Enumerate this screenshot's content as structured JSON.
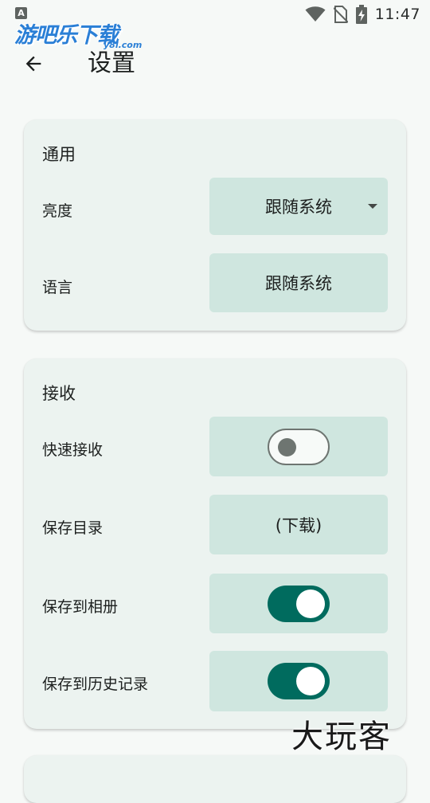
{
  "status_bar": {
    "notification_letter": "A",
    "time": "11:47",
    "icons": [
      "wifi-icon",
      "no-sim-icon",
      "battery-charging-icon"
    ]
  },
  "watermarks": {
    "logo_main": "游吧乐下载",
    "logo_sub": "y8l.com",
    "bottom": "大玩客"
  },
  "app_bar": {
    "back_icon": "arrow-left-icon",
    "title": "设置"
  },
  "sections": {
    "general": {
      "title": "通用",
      "brightness_label": "亮度",
      "brightness_value": "跟随系统",
      "language_label": "语言",
      "language_value": "跟随系统"
    },
    "receive": {
      "title": "接收",
      "quick_receive_label": "快速接收",
      "quick_receive_on": false,
      "save_dir_label": "保存目录",
      "save_dir_value": "(下载)",
      "save_album_label": "保存到相册",
      "save_album_on": true,
      "save_history_label": "保存到历史记录",
      "save_history_on": true
    }
  },
  "colors": {
    "background": "#f6f9f7",
    "card": "#ecf3f0",
    "control": "#cfe6df",
    "switch_on": "#006b5e",
    "switch_off_outline": "#6e7571"
  }
}
